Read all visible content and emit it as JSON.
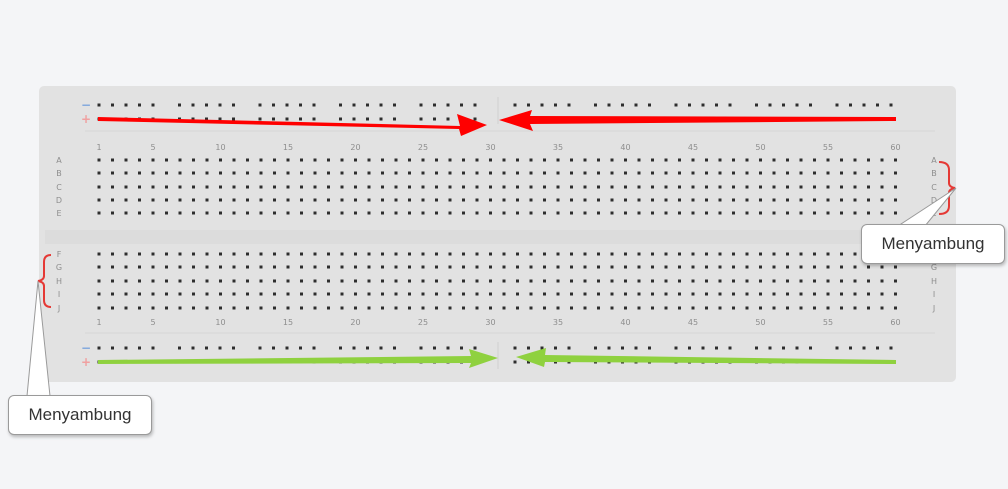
{
  "breadboard": {
    "column_labels": [
      "1",
      "5",
      "10",
      "15",
      "20",
      "25",
      "30",
      "35",
      "40",
      "45",
      "50",
      "55",
      "60"
    ],
    "top_rows": [
      "A",
      "B",
      "C",
      "D",
      "E"
    ],
    "bottom_rows": [
      "F",
      "G",
      "H",
      "I",
      "J"
    ],
    "rail_minus": "−",
    "rail_plus": "+",
    "column_count": 60
  },
  "annotations": {
    "right_label": "Menyambung",
    "left_label": "Menyambung",
    "top_arrow_color": "#ff0000",
    "bottom_arrow_color": "#8fd13f",
    "bracket_color": "#e53935"
  }
}
